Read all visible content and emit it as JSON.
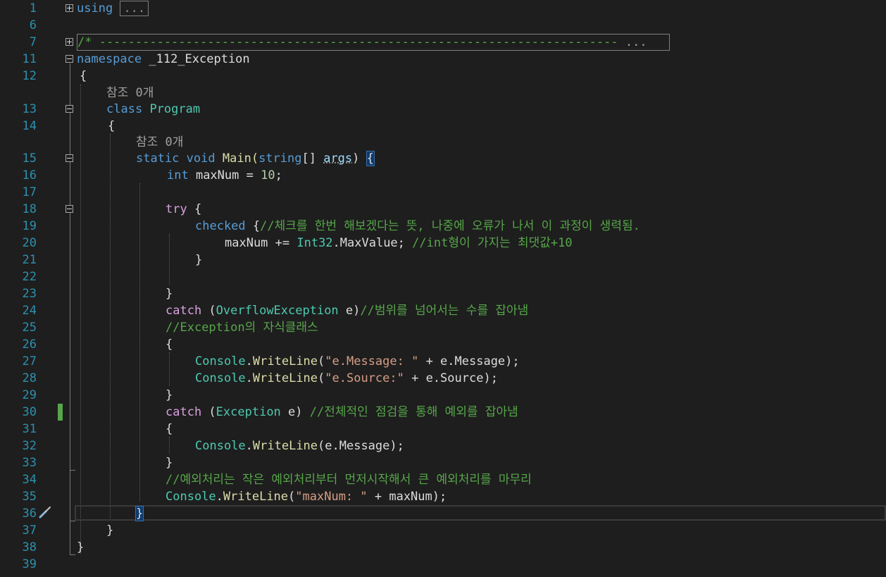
{
  "gutter": {
    "line_numbers": [
      "1",
      "6",
      "7",
      "11",
      "12",
      "",
      "13",
      "14",
      "",
      "15",
      "16",
      "17",
      "18",
      "19",
      "20",
      "21",
      "22",
      "23",
      "24",
      "25",
      "26",
      "27",
      "28",
      "29",
      "30",
      "31",
      "32",
      "33",
      "34",
      "35",
      "36",
      "37",
      "38",
      "39"
    ]
  },
  "code": {
    "l1_kw": "using",
    "l1_collapsed": "...",
    "l7_comment": "/* ------------------------------------------------------------------------",
    "l7_collapsed": "...",
    "l11_kw": "namespace",
    "l11_name": " _112_Exception",
    "l12_brace": "{",
    "ref_count_1": "참조 0개",
    "l13_kw": "class",
    "l13_name": "Program",
    "l14_brace": "{",
    "ref_count_2": "참조 0개",
    "l15_static": "static",
    "l15_void": "void",
    "l15_main": "Main(",
    "l15_string": "string",
    "l15_brackets": "[] ",
    "l15_args": "args",
    "l15_close": ") ",
    "l15_brace": "{",
    "l16_int": "int",
    "l16_rest": " maxNum = ",
    "l16_num": "10",
    "l16_end": ";",
    "l18_try": "try",
    "l18_brace": " {",
    "l19_checked": "checked",
    "l19_brace": " {",
    "l19_comment": "//체크를 한번 해보겠다는 뜻, 나중에 오류가 나서 이 과정이 생력됨.",
    "l20_var": "maxNum += ",
    "l20_type": "Int32",
    "l20_member": ".MaxValue; ",
    "l20_comment": "//int형이 가지는 최댓값+10",
    "l21_brace": "}",
    "l23_brace": "}",
    "l24_catch": "catch",
    "l24_open": " (",
    "l24_type": "OverflowException",
    "l24_rest": " e)",
    "l24_comment": "//범위를 넘어서는 수를 잡아냄",
    "l25_comment": "//Exception의 자식클래스",
    "l26_brace": "{",
    "l27_console": "Console",
    "l27_dot": ".",
    "l27_method": "WriteLine",
    "l27_open": "(",
    "l27_str": "\"e.Message: \"",
    "l27_rest": " + e.Message);",
    "l28_console": "Console",
    "l28_dot": ".",
    "l28_method": "WriteLine",
    "l28_open": "(",
    "l28_str": "\"e.Source:\"",
    "l28_rest": " + e.Source);",
    "l29_brace": "}",
    "l30_catch": "catch",
    "l30_open": " (",
    "l30_type": "Exception",
    "l30_rest": " e) ",
    "l30_comment": "//전체적인 점검을 통해 예외를 잡아냄",
    "l31_brace": "{",
    "l32_console": "Console",
    "l32_dot": ".",
    "l32_method": "WriteLine",
    "l32_rest": "(e.Message);",
    "l33_brace": "}",
    "l34_comment": "//예외처리는 작은 예외처리부터 먼저시작해서 큰 예외처리를 마무리",
    "l35_console": "Console",
    "l35_dot": ".",
    "l35_method": "WriteLine",
    "l35_open": "(",
    "l35_str": "\"maxNum: \"",
    "l35_rest": " + maxNum);",
    "l36_brace": "}",
    "l37_brace": "}",
    "l38_brace": "}"
  },
  "icons": {
    "lightbulb": "screwdriver-icon"
  },
  "colors": {
    "background": "#1e1e1e",
    "keyword": "#569cd6",
    "type": "#4ec9b0",
    "comment": "#57a64a",
    "string": "#d69d85",
    "line_number": "#2b91af"
  }
}
